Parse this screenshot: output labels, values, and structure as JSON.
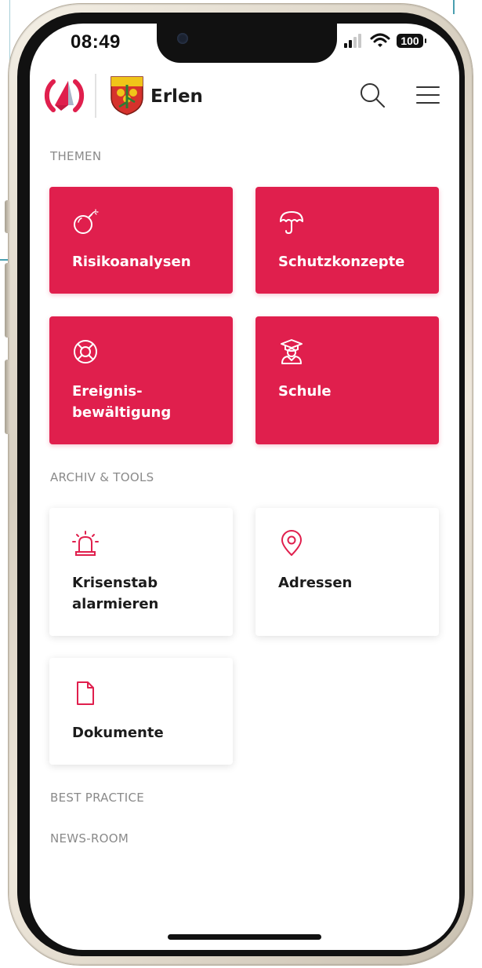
{
  "status_bar": {
    "time": "08:49",
    "battery": "100"
  },
  "header": {
    "city_name": "Erlen"
  },
  "sections": {
    "themen": {
      "label": "THEMEN",
      "tiles": [
        {
          "label": "Risikoanalysen",
          "icon": "bomb-icon"
        },
        {
          "label": "Schutzkonzepte",
          "icon": "umbrella-icon"
        },
        {
          "label": "Ereignis-\nbewältigung",
          "icon": "lifebuoy-icon"
        },
        {
          "label": "Schule",
          "icon": "graduate-icon"
        }
      ]
    },
    "archiv": {
      "label": "ARCHIV & TOOLS",
      "tiles": [
        {
          "label": "Krisenstab\nalarmieren",
          "icon": "siren-icon"
        },
        {
          "label": "Adressen",
          "icon": "location-pin-icon"
        },
        {
          "label": "Dokumente",
          "icon": "document-icon"
        }
      ]
    },
    "best_practice": {
      "label": "BEST PRACTICE"
    },
    "news_room": {
      "label": "NEWS-ROOM"
    }
  },
  "colors": {
    "accent": "#e01f4d",
    "text": "#1c1c1c",
    "muted": "#8a8a8a"
  }
}
